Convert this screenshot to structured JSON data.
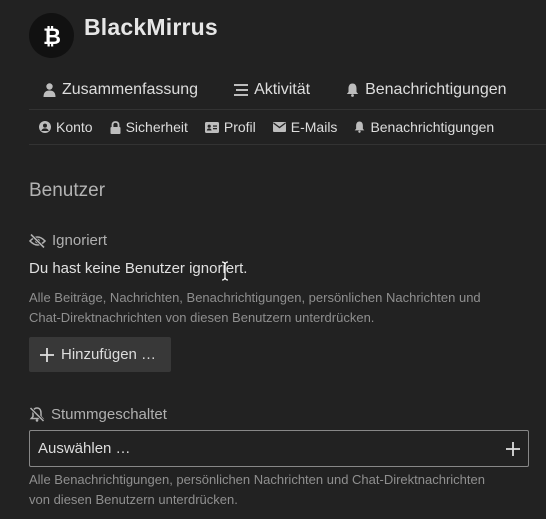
{
  "user": {
    "name": "BlackMirrus",
    "avatar_icon": "bitcoin-icon"
  },
  "nav_primary": [
    {
      "label": "Zusammenfassung",
      "icon": "user-icon"
    },
    {
      "label": "Aktivität",
      "icon": "list-icon"
    },
    {
      "label": "Benachrichtigungen",
      "icon": "bell-icon"
    }
  ],
  "nav_secondary": [
    {
      "label": "Konto",
      "icon": "account-icon"
    },
    {
      "label": "Sicherheit",
      "icon": "lock-icon"
    },
    {
      "label": "Profil",
      "icon": "id-card-icon"
    },
    {
      "label": "E-Mails",
      "icon": "envelope-icon"
    },
    {
      "label": "Benachrichtigungen",
      "icon": "bell-icon"
    }
  ],
  "section": {
    "title": "Benutzer"
  },
  "ignored": {
    "label": "Ignoriert",
    "empty_text": "Du hast keine Benutzer ignoriert.",
    "help_line1": "Alle Beiträge, Nachrichten, Benachrichtigungen, persönlichen Nachrichten und",
    "help_line2": "Chat-Direktnachrichten von diesen Benutzern unterdrücken.",
    "add_button": "Hinzufügen …"
  },
  "muted": {
    "label": "Stummgeschaltet",
    "select_placeholder": "Auswählen …",
    "help_line1": "Alle Benachrichtigungen, persönlichen Nachrichten und Chat-Direktnachrichten",
    "help_line2": "von diesen Benutzern unterdrücken."
  },
  "colors": {
    "background": "#222222",
    "text": "#dddddd",
    "muted_text": "#8f8f8f",
    "button_bg": "#383838"
  }
}
